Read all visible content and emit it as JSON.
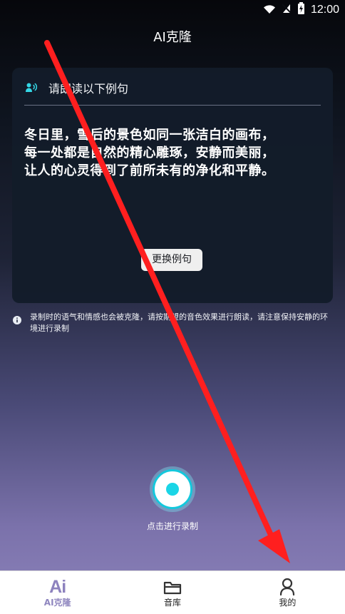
{
  "status_bar": {
    "time": "12:00",
    "icons": [
      "wifi-icon",
      "no-signal-icon",
      "battery-charging-icon"
    ]
  },
  "app": {
    "title": "AI克隆"
  },
  "prompt_card": {
    "header_icon": "speaker-person-icon",
    "header_label": "请朗读以下例句",
    "passage_lines": [
      "冬日里，雪后的景色如同一张洁白的画布，",
      "每一处都是自然的精心雕琢，安静而美丽，",
      "让人的心灵得到了前所未有的净化和平静。"
    ],
    "change_button": "更换例句"
  },
  "notice": {
    "icon": "info-icon",
    "text": "录制时的语气和情感也会被克隆，请按期望的音色效果进行朗读，请注意保持安静的环境进行录制"
  },
  "record": {
    "label": "点击进行录制",
    "accent": "#1ad5e6"
  },
  "bottom_nav": {
    "items": [
      {
        "label": "AI克隆",
        "icon": "ai-logo-icon",
        "active": true
      },
      {
        "label": "音库",
        "icon": "folder-icon",
        "active": false
      },
      {
        "label": "我的",
        "icon": "user-icon",
        "active": false
      }
    ]
  },
  "overlay": {
    "annotation": "red-arrow-overlay",
    "color": "#ff1f1f"
  }
}
